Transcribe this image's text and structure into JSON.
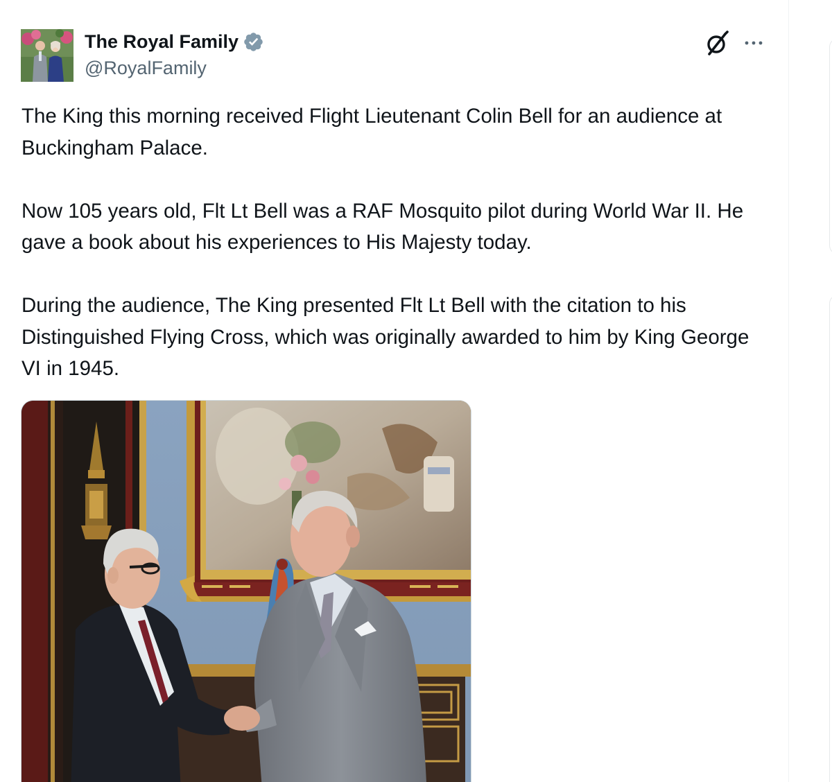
{
  "author": {
    "display_name": "The Royal Family",
    "handle": "@RoyalFamily",
    "verified": true
  },
  "icons": {
    "verified": "verified-badge-icon",
    "grok": "grok-icon",
    "more": "more-options-icon"
  },
  "tweet": {
    "paragraphs": [
      "The King this morning received Flight Lieutenant Colin Bell for an audience at Buckingham Palace.",
      "Now 105 years old, Flt Lt Bell was a RAF Mosquito pilot during World War II. He gave a book about his experiences to His Majesty today.",
      "During the audience, The King presented Flt Lt Bell with the citation to his Distinguished Flying Cross, which was originally awarded to him by King George VI in 1945."
    ]
  },
  "colors": {
    "text": "#0f1419",
    "secondary_text": "#536471",
    "verified_blue": "#829aab",
    "border": "#cfd9de"
  }
}
